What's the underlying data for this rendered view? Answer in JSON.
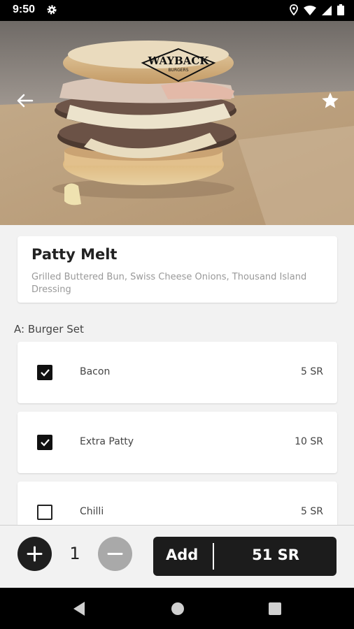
{
  "status_bar": {
    "time": "9:50"
  },
  "hero": {
    "logo_text": "WAYBACK",
    "logo_subtext": "BURGERS"
  },
  "product": {
    "title": "Patty Melt",
    "description": "Grilled Buttered Bun, Swiss Cheese Onions, Thousand Island Dressing"
  },
  "section": {
    "title": "A: Burger Set"
  },
  "options": [
    {
      "name": "Bacon",
      "price": "5 SR",
      "checked": true
    },
    {
      "name": "Extra Patty",
      "price": "10 SR",
      "checked": true
    },
    {
      "name": "Chilli",
      "price": "5 SR",
      "checked": false
    }
  ],
  "order": {
    "quantity": "1",
    "add_label": "Add",
    "total": "51 SR"
  },
  "colors": {
    "dark": "#1c1c1c",
    "background": "#f2f2f2",
    "minus_disabled": "#a9a9a9"
  }
}
